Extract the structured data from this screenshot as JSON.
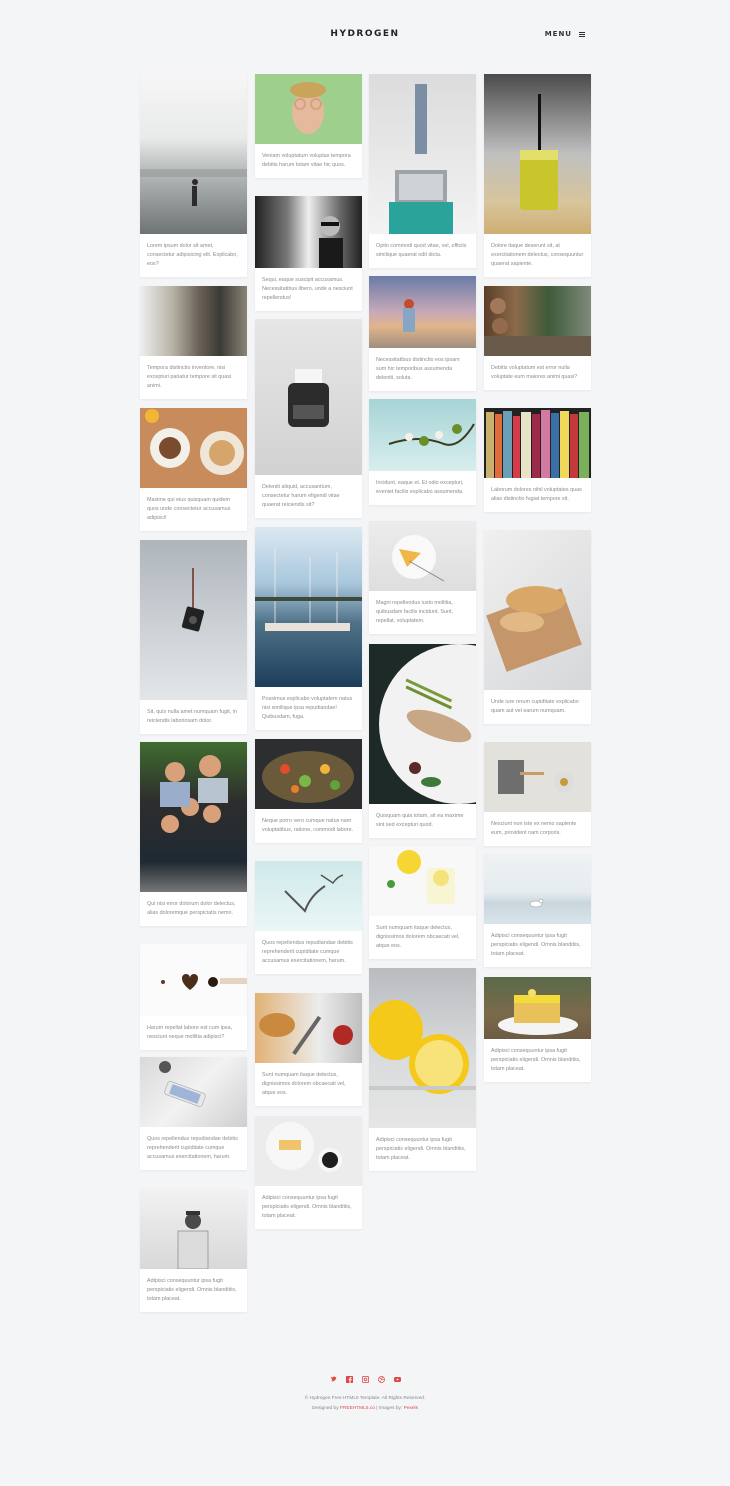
{
  "header": {
    "brand": "HYDROGEN",
    "menu_label": "MENU"
  },
  "cards": [
    {
      "caption": "Lorem ipsum dolor sit amet, consectetur adipisicing elit. Explicabo, eos?"
    },
    {
      "caption": "Tempora distinctio inventore, nisi excepturi pariatur tempore sit quasi animi."
    },
    {
      "caption": "Maxime qui eius quisquam quidem quos unde consectetur accusamus adipisci!"
    },
    {
      "caption": "Sit, quis nulla amet numquam fugit, in reiciendis laboriosam dolor."
    },
    {
      "caption": "Qui nisi error dolorum dolor delectus, alias doloremque perspiciatis nemo."
    },
    {
      "caption": "Harum repellat labore est cum ipsa, nesciunt neque mollitia adipisci?"
    },
    {
      "caption": "Quos repellendus repudiandae debitis reprehenderit cupiditate cumque accusamus exercitationem, harum."
    },
    {
      "caption": "Adipisci consequuntur ipsa fugit perspiciatis eligendi. Omnis blanditiis, totam placeat."
    },
    {
      "caption": "Veniam voluptatum voluptas tempora debitis harum totam vitae hic quos."
    },
    {
      "caption": "Sequi, eaque suscipit accusamus. Necessitatibus libero, unde a nesciunt repellendus!"
    },
    {
      "caption": "Deleniti aliquid, accusantium, consectetur harum eligendi vitae quaerat reiciendis sit?"
    },
    {
      "caption": "Possimus explicabo voluptatem natus nisi similique ipsa repudiandae! Quibusdam, fuga."
    },
    {
      "caption": "Neque porro vero cumque natus nam voluptatibus, ratione, commodi labore."
    },
    {
      "caption": "Quos repellendus repudiandae debitis reprehenderit cupiditate cumque accusamus exercitationem, harum."
    },
    {
      "caption": "Sunt numquam itaque delectus, dignissimos dolorem obcaecati vel, atque eos."
    },
    {
      "caption": "Adipisci consequuntur ipsa fugit perspiciatis eligendi. Omnis blanditiis, totam placeat."
    },
    {
      "caption": "Optio commodi quod vitae, vel, officiis similique quaerat odit dicta."
    },
    {
      "caption": "Necessitatibus distinctio eos ipsam sum hic temporibus assumenda deleniti, soluta."
    },
    {
      "caption": "Incidunt, eaque et. Et odio excepturi, eveniet facilis explicabo assumenda."
    },
    {
      "caption": "Magni repellendus iusto mollitia, quibusdam facilis incidunt. Sunt, repellat, voluptatem."
    },
    {
      "caption": "Quisquam quia totam, sit ea maxime sint sed excepturi quod."
    },
    {
      "caption": "Sunt numquam itaque delectus, dignissimos dolorem obcaecati vel, atque eos."
    },
    {
      "caption": "Adipisci consequuntur ipsa fugit perspiciatis eligendi. Omnis blanditiis, totam placeat."
    },
    {
      "caption": "Dolore itaque deserunt sit, at exercitationem delectus, consequuntur quaerat sapiente."
    },
    {
      "caption": "Debitis voluptatum est error nulla voluptate eum maiores animi quasi?"
    },
    {
      "caption": "Laborum dolores nihil voluptates quas alias distinctio fugiat tempore sit."
    },
    {
      "caption": "Unde iure rerum cupiditate explicabo quam aut vel earum numquam."
    },
    {
      "caption": "Nesciunt non iste ex nemo sapiente eum, provident nam corporis."
    },
    {
      "caption": "Adipisci consequuntur ipsa fugit perspiciatis eligendi. Omnis blanditiis, totam placeat."
    },
    {
      "caption": "Adipisci consequuntur ipsa fugit perspiciatis eligendi. Omnis blanditiis, totam placeat."
    }
  ],
  "footer": {
    "social_icons": [
      "twitter-icon",
      "facebook-icon",
      "instagram-icon",
      "dribbble-icon",
      "youtube-icon"
    ],
    "copyright": "© Hydrogen Free HTML5 Template. All Rights Reserved.",
    "designed_prefix": "Designed by",
    "designer": "FREEHTML5.co",
    "images_prefix": "| Images by:",
    "images_source": "Pexels"
  },
  "colors": {
    "background": "#f4f5f7",
    "accent": "#e04848",
    "text": "#8a8a8a"
  }
}
